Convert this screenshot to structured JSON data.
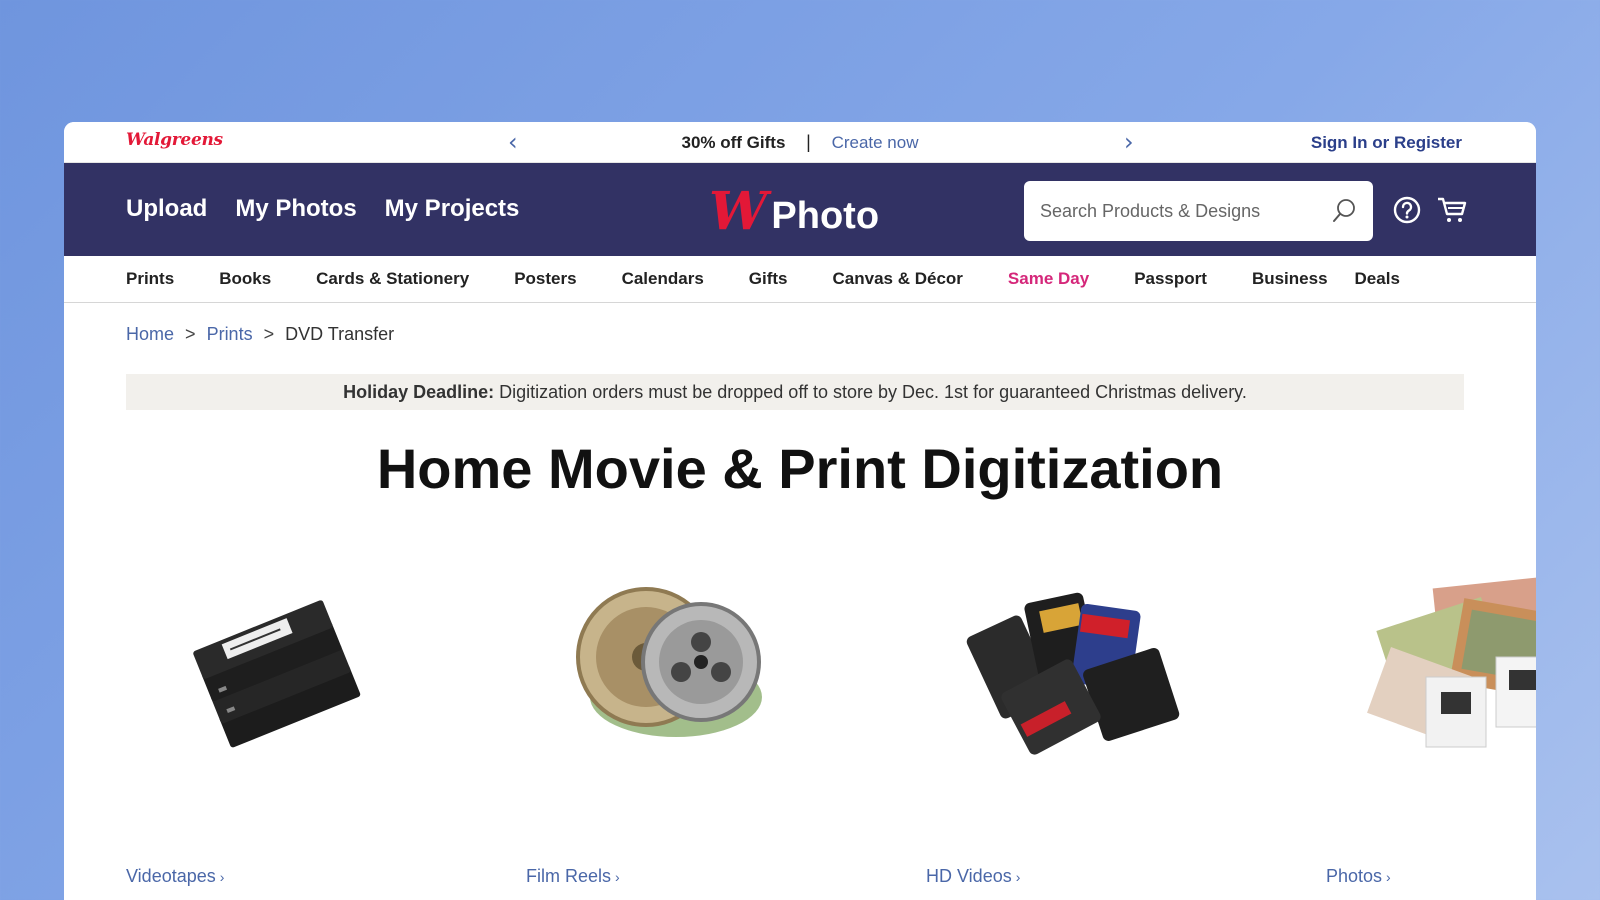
{
  "promo": {
    "brand": "Walgreens",
    "text": "30% off Gifts",
    "separator": "|",
    "link": "Create now",
    "sign_in": "Sign In or Register"
  },
  "header": {
    "nav": [
      "Upload",
      "My Photos",
      "My Projects"
    ],
    "logo_w": "W",
    "logo_text": "Photo",
    "search_placeholder": "Search Products & Designs",
    "icons": [
      "search-icon",
      "help-icon",
      "cart-icon"
    ]
  },
  "categories": [
    {
      "label": "Prints",
      "highlight": false
    },
    {
      "label": "Books",
      "highlight": false
    },
    {
      "label": "Cards & Stationery",
      "highlight": false
    },
    {
      "label": "Posters",
      "highlight": false
    },
    {
      "label": "Calendars",
      "highlight": false
    },
    {
      "label": "Gifts",
      "highlight": false
    },
    {
      "label": "Canvas & Décor",
      "highlight": false
    },
    {
      "label": "Same Day",
      "highlight": true
    },
    {
      "label": "Passport",
      "highlight": false
    },
    {
      "label": "Business",
      "highlight": false
    },
    {
      "label": "Deals",
      "highlight": false
    }
  ],
  "breadcrumb": {
    "home": "Home",
    "sep": ">",
    "prints": "Prints",
    "current": "DVD Transfer"
  },
  "notice": {
    "label": "Holiday Deadline:",
    "text": " Digitization orders must be dropped off to store by Dec. 1st for guaranteed Christmas delivery."
  },
  "title": "Home Movie & Print Digitization",
  "cards": [
    {
      "label": "Videotapes",
      "chevron": "›"
    },
    {
      "label": "Film Reels",
      "chevron": "›"
    },
    {
      "label": "HD Videos",
      "chevron": "›"
    },
    {
      "label": "Photos",
      "chevron": "›"
    }
  ],
  "colors": {
    "header_bg": "#323264",
    "brand_red": "#e31837",
    "link_blue": "#4a67a8",
    "same_day_pink": "#d5277a"
  }
}
